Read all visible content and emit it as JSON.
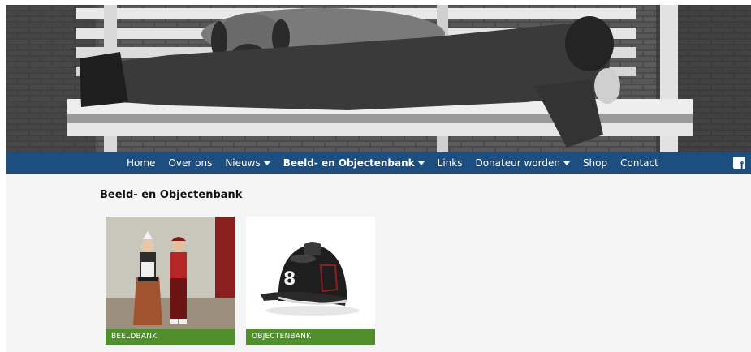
{
  "nav": {
    "items": [
      {
        "label": "Home",
        "dropdown": false,
        "active": false
      },
      {
        "label": "Over ons",
        "dropdown": false,
        "active": false
      },
      {
        "label": "Nieuws",
        "dropdown": true,
        "active": false
      },
      {
        "label": "Beeld- en Objectenbank",
        "dropdown": true,
        "active": true
      },
      {
        "label": "Links",
        "dropdown": false,
        "active": false
      },
      {
        "label": "Donateur worden",
        "dropdown": true,
        "active": false
      },
      {
        "label": "Shop",
        "dropdown": false,
        "active": false
      },
      {
        "label": "Contact",
        "dropdown": false,
        "active": false
      }
    ],
    "social_icon": "facebook-icon",
    "social_glyph": "f",
    "bar_color": "#1c4f80"
  },
  "page": {
    "title": "Beeld- en Objectenbank"
  },
  "tiles": [
    {
      "label": "BEELDBANK",
      "image": "children-in-traditional-costume"
    },
    {
      "label": "OBJECTENBANK",
      "image": "fire-helmet"
    }
  ],
  "colors": {
    "tile_label_bg": "#4f8f2c",
    "page_bg": "#f5f5f5"
  }
}
